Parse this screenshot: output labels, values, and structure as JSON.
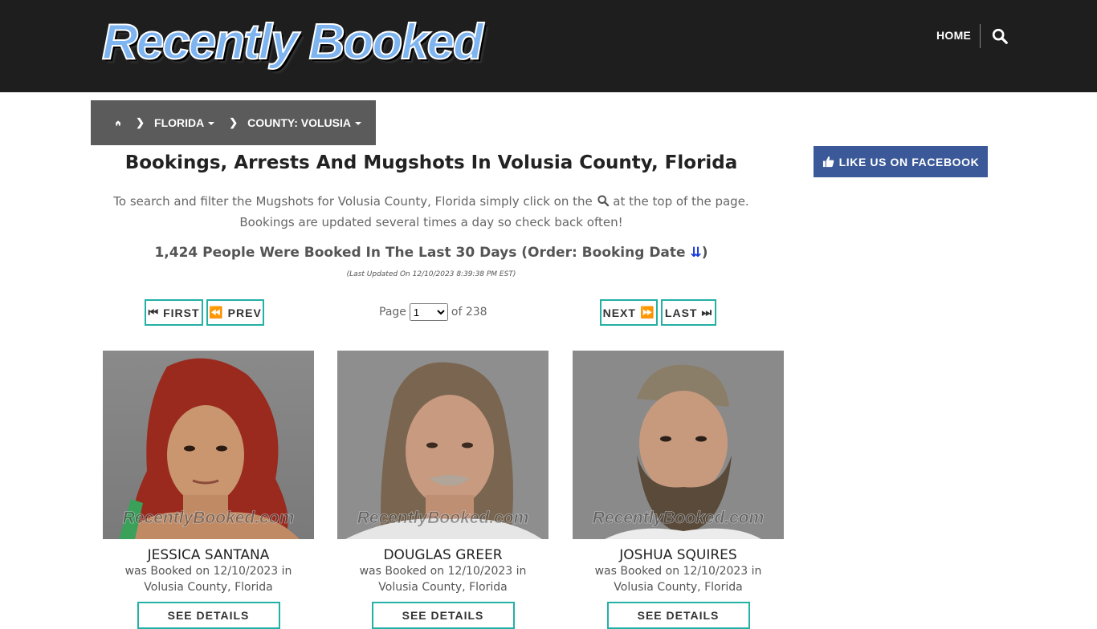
{
  "header": {
    "logo_text": "Recently Booked",
    "nav_home": "HOME",
    "search_icon": "search-icon"
  },
  "breadcrumb": {
    "home_icon": "home-icon",
    "items": [
      {
        "label": "FLORIDA"
      },
      {
        "label": "COUNTY: VOLUSIA"
      }
    ]
  },
  "sidebar": {
    "facebook_label": "LIKE US ON FACEBOOK"
  },
  "main": {
    "title": "Bookings, Arrests And Mugshots In Volusia County, Florida",
    "desc_line1_pre": "To search and filter the Mugshots for Volusia County, Florida simply click on the",
    "desc_line1_post": "at the top of the page.",
    "desc_line2": "Bookings are updated several times a day so check back often!",
    "count_text": "1,424 People Were Booked In The Last 30 Days (Order: Booking Date",
    "count_close": ")",
    "updated": "(Last Updated On 12/10/2023 8:39:38 PM EST)"
  },
  "pagination": {
    "first": "FIRST",
    "prev": "PREV",
    "next": "NEXT",
    "last": "LAST",
    "page_label": "Page",
    "page_value": "1",
    "of_label": "of 238"
  },
  "watermark": "RecentlyBooked.com",
  "cards": [
    {
      "name": "JESSICA SANTANA",
      "booked_line1": "was Booked on 12/10/2023 in",
      "booked_line2": "Volusia County, Florida",
      "details": "SEE DETAILS"
    },
    {
      "name": "DOUGLAS GREER",
      "booked_line1": "was Booked on 12/10/2023 in",
      "booked_line2": "Volusia County, Florida",
      "details": "SEE DETAILS"
    },
    {
      "name": "JOSHUA SQUIRES",
      "booked_line1": "was Booked on 12/10/2023 in",
      "booked_line2": "Volusia County, Florida",
      "details": "SEE DETAILS"
    }
  ],
  "colors": {
    "header_bg": "#1e1e1e",
    "breadcrumb_bg": "#5b5b5b",
    "facebook_blue": "#3b5998",
    "teal_border": "#23b0a5"
  }
}
